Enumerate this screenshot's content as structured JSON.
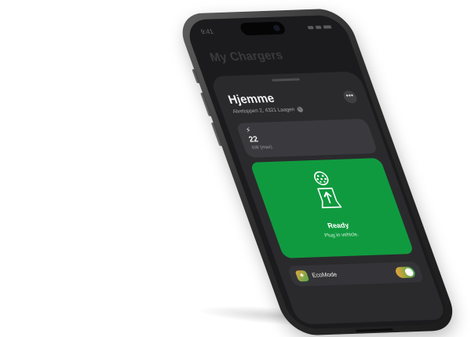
{
  "status_bar": {
    "time": "9:41"
  },
  "header": {
    "title": "My Chargers"
  },
  "charger": {
    "name": "Hjemme",
    "address": "Alvetoppen 2, 4321 Laagen",
    "more_icon": "ellipsis-icon",
    "power": {
      "icon": "bolt-icon",
      "value": "22",
      "unit": "kW (max)"
    },
    "status": {
      "icon": "ev-plug-icon",
      "title": "Ready",
      "subtitle": "Plug in vehicle."
    }
  },
  "ecomode": {
    "label": "EcoMode",
    "icon": "eco-leaf-icon",
    "enabled": true
  },
  "colors": {
    "ready_green": "#109a3f",
    "screen_bg": "#1b1b1d",
    "sheet_bg": "#2a2a2d",
    "card_bg": "#3a3a3e"
  }
}
